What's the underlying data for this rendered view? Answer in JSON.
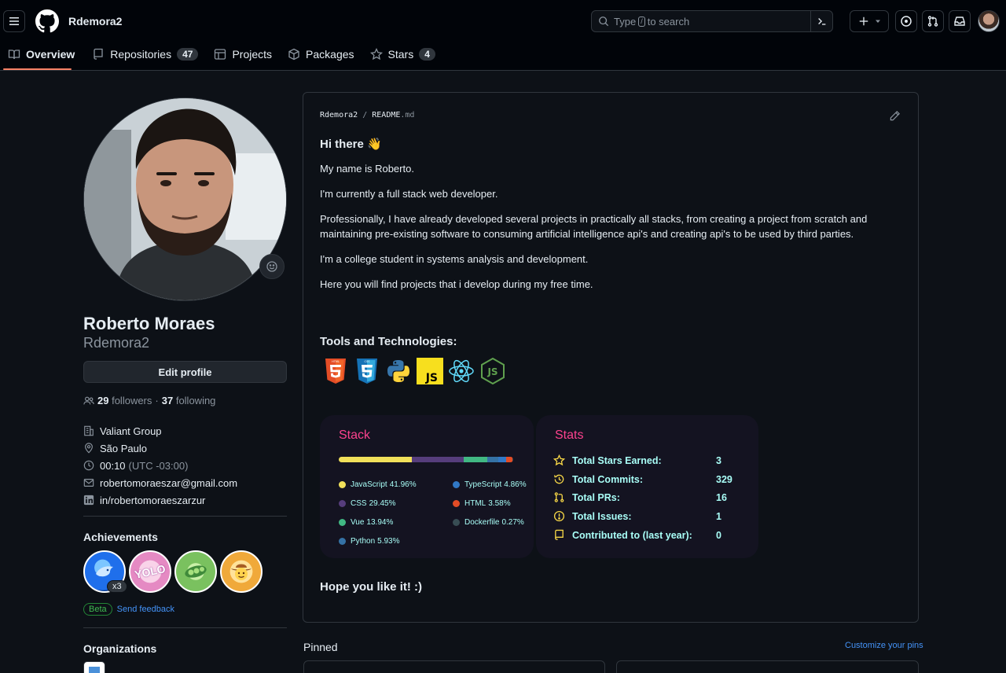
{
  "header": {
    "username": "Rdemora2",
    "search": {
      "prefix": "Type",
      "key": "/",
      "suffix": "to search"
    }
  },
  "tabs": [
    {
      "label": "Overview"
    },
    {
      "label": "Repositories",
      "count": "47"
    },
    {
      "label": "Projects"
    },
    {
      "label": "Packages"
    },
    {
      "label": "Stars",
      "count": "4"
    }
  ],
  "profile": {
    "name": "Roberto Moraes",
    "login": "Rdemora2",
    "edit_label": "Edit profile",
    "followers_count": "29",
    "followers_label": "followers",
    "dot": "·",
    "following_count": "37",
    "following_label": "following",
    "company": "Valiant Group",
    "location": "São Paulo",
    "time": "00:10",
    "timezone": "(UTC -03:00)",
    "email": "robertomoraeszar@gmail.com",
    "linkedin": "in/robertomoraeszarzur"
  },
  "achievements": {
    "title": "Achievements",
    "badges": [
      {
        "name": "pull-shark",
        "label": "",
        "color": "#1f6feb"
      },
      {
        "name": "yolo",
        "label": "YOLO",
        "color": "#e58ac3"
      },
      {
        "name": "pair-extraordinaire",
        "label": "",
        "color": "#7ac15f"
      },
      {
        "name": "quickdraw",
        "label": "",
        "color": "#f0a93a"
      }
    ],
    "multiplier": "x3",
    "beta_label": "Beta",
    "feedback_label": "Send feedback"
  },
  "organizations": {
    "title": "Organizations"
  },
  "readme": {
    "owner": "Rdemora2",
    "separator": "/",
    "file": "README",
    "ext": ".md",
    "heading": "Hi there 👋",
    "paragraphs": [
      "My name is Roberto.",
      "I'm currently a full stack web developer.",
      "Professionally, I have already developed several projects in practically all stacks, from creating a project from scratch and maintaining pre-existing software to consuming artificial intelligence api's and creating api's to be used by third parties.",
      "I'm a college student in systems analysis and development.",
      "Here you will find projects that i develop during my free time."
    ],
    "tools_heading": "Tools and Technologies:",
    "tools": [
      "html5-icon",
      "css3-icon",
      "python-icon",
      "javascript-icon",
      "react-icon",
      "nodejs-icon"
    ],
    "closing": "Hope you like it! :)"
  },
  "stack_card": {
    "title": "Stack",
    "languages": [
      {
        "name": "JavaScript",
        "pct": "41.96%",
        "value": 41.96,
        "color": "#f1e05a"
      },
      {
        "name": "CSS",
        "pct": "29.45%",
        "value": 29.45,
        "color": "#563d7c"
      },
      {
        "name": "Vue",
        "pct": "13.94%",
        "value": 13.94,
        "color": "#41b883"
      },
      {
        "name": "Python",
        "pct": "5.93%",
        "value": 5.93,
        "color": "#3572a5"
      },
      {
        "name": "TypeScript",
        "pct": "4.86%",
        "value": 4.86,
        "color": "#3178c6"
      },
      {
        "name": "HTML",
        "pct": "3.58%",
        "value": 3.58,
        "color": "#e34c26"
      },
      {
        "name": "Dockerfile",
        "pct": "0.27%",
        "value": 0.27,
        "color": "#384d54"
      }
    ]
  },
  "stats_card": {
    "title": "Stats",
    "rows": [
      {
        "label": "Total Stars Earned:",
        "value": "3",
        "icon": "star-icon"
      },
      {
        "label": "Total Commits:",
        "value": "329",
        "icon": "history-icon"
      },
      {
        "label": "Total PRs:",
        "value": "16",
        "icon": "pull-request-icon"
      },
      {
        "label": "Total Issues:",
        "value": "1",
        "icon": "issue-icon"
      },
      {
        "label": "Contributed to (last year):",
        "value": "0",
        "icon": "repo-icon"
      }
    ]
  },
  "pinned": {
    "title": "Pinned",
    "customize_label": "Customize your pins"
  }
}
